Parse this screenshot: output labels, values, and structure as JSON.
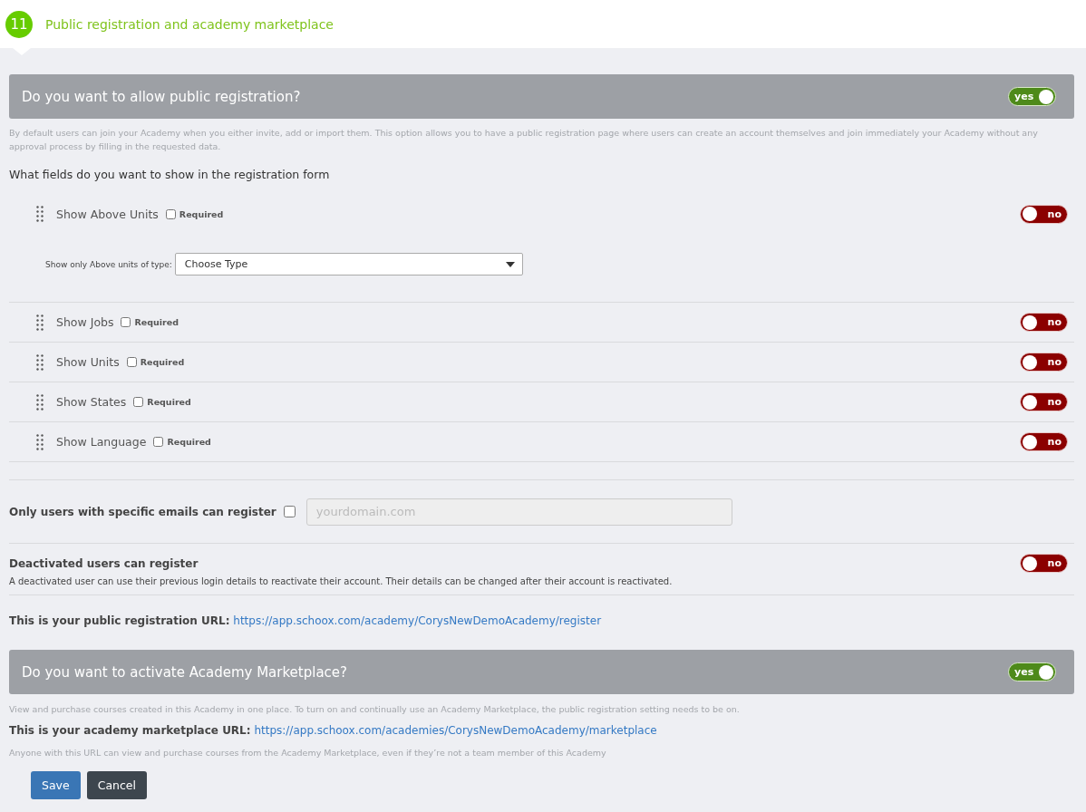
{
  "header": {
    "step": "11",
    "title": "Public registration and academy marketplace"
  },
  "registration": {
    "heading": "Do you want to allow public registration?",
    "toggle": {
      "label": "yes",
      "on": true
    },
    "description": "By default users can join your Academy when you either invite, add or import them. This option allows you to have a public registration page where users can create an account themselves and join immediately your Academy without any approval process by filling in the requested data.",
    "fields_prompt": "What fields do you want to show in the registration form",
    "fields": [
      {
        "label": "Show Above Units",
        "required_label": "Required",
        "required": false,
        "toggle": {
          "label": "no",
          "on": false
        },
        "filter": {
          "label": "Show only Above units of type:",
          "select": "Choose Type"
        }
      },
      {
        "label": "Show Jobs",
        "required_label": "Required",
        "required": false,
        "toggle": {
          "label": "no",
          "on": false
        }
      },
      {
        "label": "Show Units",
        "required_label": "Required",
        "required": false,
        "toggle": {
          "label": "no",
          "on": false
        }
      },
      {
        "label": "Show States",
        "required_label": "Required",
        "required": false,
        "toggle": {
          "label": "no",
          "on": false
        }
      },
      {
        "label": "Show Language",
        "required_label": "Required",
        "required": false,
        "toggle": {
          "label": "no",
          "on": false
        }
      }
    ],
    "email_restriction": {
      "label": "Only users with specific emails can register",
      "checked": false,
      "placeholder": "yourdomain.com"
    },
    "deactivated": {
      "title": "Deactivated users can register",
      "description": "A deactivated user can use their previous login details to reactivate their account. Their details can be changed after their account is reactivated.",
      "toggle": {
        "label": "no",
        "on": false
      }
    },
    "url": {
      "label": "This is your public registration URL:",
      "link": "https://app.schoox.com/academy/CorysNewDemoAcademy/register"
    }
  },
  "marketplace": {
    "heading": "Do you want to activate Academy Marketplace?",
    "toggle": {
      "label": "yes",
      "on": true
    },
    "description": "View and purchase courses created in this Academy in one place. To turn on and continually use an Academy Marketplace, the public registration setting needs to be on.",
    "url": {
      "label": "This is your academy marketplace URL:",
      "link": "https://app.schoox.com/academies/CorysNewDemoAcademy/marketplace"
    },
    "note": "Anyone with this URL can view and purchase courses from the Academy Marketplace, even if they’re not a team member of this Academy"
  },
  "buttons": [
    {
      "label": "Save",
      "kind": "primary"
    },
    {
      "label": "Cancel",
      "kind": "secondary"
    }
  ]
}
